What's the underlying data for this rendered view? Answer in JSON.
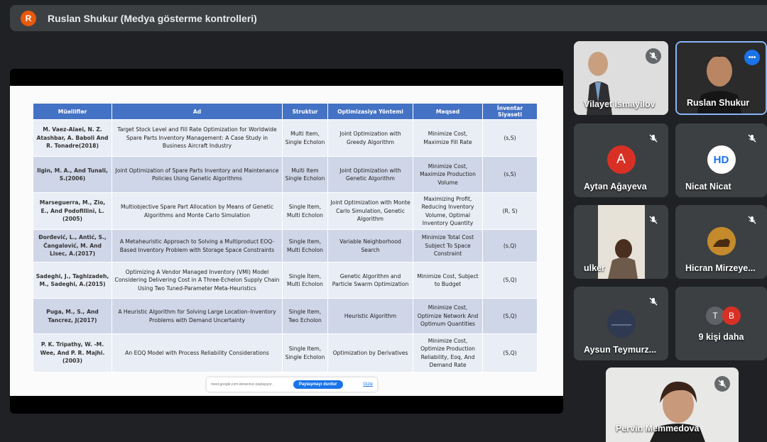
{
  "top_bar": {
    "avatar_letter": "R",
    "title": "Ruslan Shukur (Medya gösterme kontrolleri)"
  },
  "table": {
    "headers": [
      "Müəlliflər",
      "Ad",
      "Struktur",
      "Optimizasiya Yöntemi",
      "Məqsəd",
      "İnventar Siyasəti"
    ],
    "rows": [
      [
        "M. Vaez-Alaei, N. Z. Atashbar, A. Baboli And R. Tonadre(2018)",
        "Target Stock Level and Fill Rate Optimization for Worldwide Spare Parts Inventory Management: A Case Study in Business Aircraft Industry",
        "Multi Item, Single Echolon",
        "Joint Optimization with Greedy Algorithm",
        "Minimize Cost, Maximize Fill Rate",
        "(s,S)"
      ],
      [
        "Ilgin, M. A., And Tunali, S.(2006)",
        "Joint Optimization of Spare Parts Inventory and Maintenance Policies Using Genetic Algorithms",
        "Multi Item Single Echolon",
        "Joint Optimization with Genetic Algorithm",
        "Minimize Cost, Maximize Production Volume",
        "(s,S)"
      ],
      [
        "Marseguerra, M., Zio, E., And Podofillini, L. (2005)",
        "Multiobjective Spare Part Allocation by Means of Genetic Algorithms and Monte Carlo Simulation",
        "Single Item, Multi Echolon",
        "Joint Optimization with Monte Carlo Simulation, Genetic Algorithm",
        "Maximizing Profit, Reducing Inventory Volume, Optimal Inventory Quantity",
        "(R, S)"
      ],
      [
        "Đorđević, L., Antić, S., Čangalović, M. And Lisec, A.(2017)",
        "A Metaheuristic Approach to Solving a Multiproduct EOQ-Based Inventory Problem with Storage Space Constraints",
        "Single Item, Multi Echolon",
        "Variable Neighborhood Search",
        "Minimize Total Cost Subject To Space Constraint",
        "(s,Q)"
      ],
      [
        "Sadeghi, J., Taghizadeh, M., Sadeghi, A.(2015)",
        "Optimizing A Vendor Managed Inventory (VMI) Model Considering Delivering Cost in A Three-Echelon Supply Chain Using Two Tuned-Parameter Meta-Heuristics",
        "Single İtem, Multi Echolon",
        "Genetic Algorithm and Particle Swarm Optimization",
        "Minimize Cost, Subject to Budget",
        "(S,Q)"
      ],
      [
        "Puga, M., S., And Tancrez, J(2017)",
        "A Heuristic Algorithm for Solving Large Location–Inventory Problems with Demand Uncertainty",
        "Single Item, Two Echolon",
        "Heuristic Algorithm",
        "Minimize Cost, Optimize Network And Optimum Quantities",
        "(S,Q)"
      ],
      [
        "P. K. Tripathy, W. -M. Wee, And P. R. Majhi. (2003)",
        "An EOQ Model with Process Reliability Considerations",
        "Single Item, Single Echolon",
        "Optimization by Derivatives",
        "Minimize Cost, Optimize Production Reliability, Eoq, And Demand Rate",
        "(S,Q)"
      ]
    ]
  },
  "share_bar": {
    "text": "meet.google.com ekranınızı paylaşıyor.",
    "stop_label": "Paylaşmayı durdur",
    "hide_label": "Gizle"
  },
  "participants": {
    "p1": "Vilayet Ismayilov",
    "p2": "Ruslan Shukur",
    "p3": "Aytən Ağayeva",
    "p3_initial": "A",
    "p4": "Nicat Nicat",
    "p4_logo": "HD",
    "p5": "ulker",
    "p6": "Hicran Mirzeye...",
    "p7": "Aysun Teymurz...",
    "p8": "9 kişi daha",
    "p8_initials": [
      "T",
      "B"
    ],
    "p9": "Pervin Memmedova"
  },
  "colors": {
    "header_blue": "#4472c4",
    "row_light": "#e9edf5",
    "row_dark": "#cfd6e8",
    "speaking_border": "#8ab4f8",
    "avatar_a": "#d93025"
  }
}
